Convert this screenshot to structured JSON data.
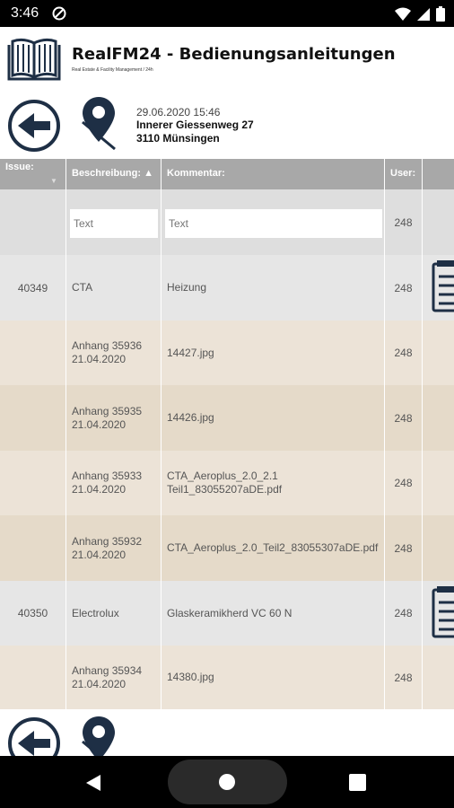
{
  "status_bar": {
    "time": "3:46"
  },
  "header": {
    "title": "RealFM24 - Bedienungsanleitungen",
    "subtitle": "Real Estate & Facility Management / 24h"
  },
  "info": {
    "date": "29.06.2020 15:46",
    "street": "Innerer Giessenweg 27",
    "city": "3110 Münsingen"
  },
  "table": {
    "columns": {
      "issue": "Issue:",
      "beschreibung": "Beschreibung:",
      "kommentar": "Kommentar:",
      "user": "User:"
    },
    "sort_indicator": "▲",
    "filter": {
      "desc_placeholder": "Text",
      "comm_placeholder": "Text",
      "user": "248"
    },
    "rows": [
      {
        "issue": "40349",
        "desc": "CTA",
        "comment": "Heizung",
        "user": "248"
      },
      {
        "issue": "",
        "desc_line1": "Anhang 35936",
        "desc_line2": "21.04.2020",
        "comment": "14427.jpg",
        "user": "248"
      },
      {
        "issue": "",
        "desc_line1": "Anhang 35935",
        "desc_line2": "21.04.2020",
        "comment": "14426.jpg",
        "user": "248"
      },
      {
        "issue": "",
        "desc_line1": "Anhang 35933",
        "desc_line2": "21.04.2020",
        "comment_line1": "CTA_Aeroplus_2.0_2.1",
        "comment_line2": "Teil1_83055207aDE.pdf",
        "user": "248"
      },
      {
        "issue": "",
        "desc_line1": "Anhang 35932",
        "desc_line2": "21.04.2020",
        "comment": "CTA_Aeroplus_2.0_Teil2_83055307aDE.pdf",
        "user": "248"
      },
      {
        "issue": "40350",
        "desc": "Electrolux",
        "comment": "Glaskeramikherd VC 60 N",
        "user": "248"
      },
      {
        "issue": "",
        "desc_line1": "Anhang 35934",
        "desc_line2": "21.04.2020",
        "comment": "14380.jpg",
        "user": "248"
      }
    ]
  },
  "colors": {
    "brand_navy": "#1e2f45",
    "header_gray": "#a8a8a8",
    "issue_row": "#e6e6e6",
    "attachment_row_light": "#ece3d7",
    "attachment_row_dark": "#e5dac9"
  }
}
